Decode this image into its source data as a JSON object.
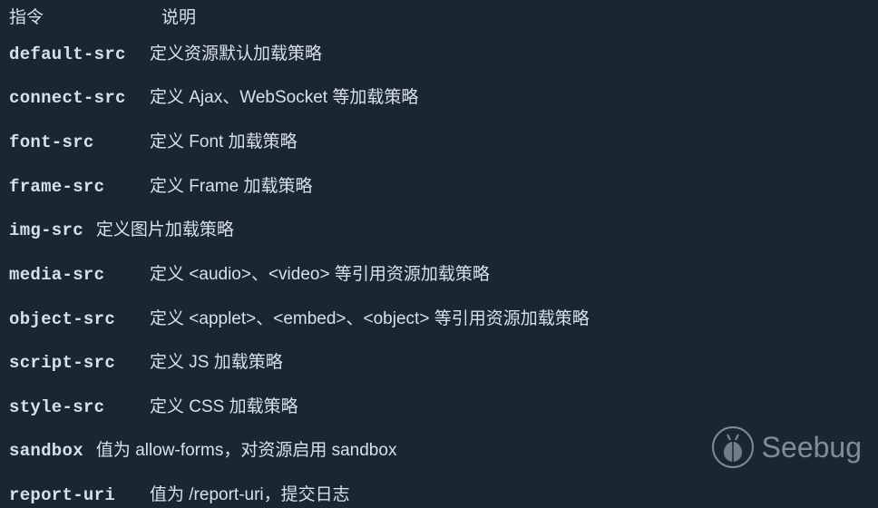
{
  "header": {
    "col1": "指令",
    "col2": "说明"
  },
  "rows": [
    {
      "dir": "default-src",
      "desc": "定义资源默认加载策略",
      "tight": false
    },
    {
      "dir": "connect-src",
      "desc": "定义 Ajax、WebSocket 等加载策略",
      "tight": false
    },
    {
      "dir": "font-src",
      "desc": "定义 Font 加载策略",
      "tight": false
    },
    {
      "dir": "frame-src",
      "desc": "定义 Frame 加载策略",
      "tight": false
    },
    {
      "dir": "img-src",
      "desc": "定义图片加载策略",
      "tight": true
    },
    {
      "dir": "media-src",
      "desc": "定义 <audio>、<video> 等引用资源加载策略",
      "tight": false
    },
    {
      "dir": "object-src",
      "desc": "定义 <applet>、<embed>、<object> 等引用资源加载策略",
      "tight": false
    },
    {
      "dir": "script-src",
      "desc": "定义 JS 加载策略",
      "tight": false
    },
    {
      "dir": "style-src",
      "desc": "定义 CSS 加载策略",
      "tight": false
    },
    {
      "dir": "sandbox",
      "desc": "值为 allow-forms，对资源启用 sandbox",
      "tight": true
    },
    {
      "dir": "report-uri",
      "desc": "值为 /report-uri，提交日志",
      "tight": false
    }
  ],
  "watermark": {
    "text": "Seebug"
  }
}
